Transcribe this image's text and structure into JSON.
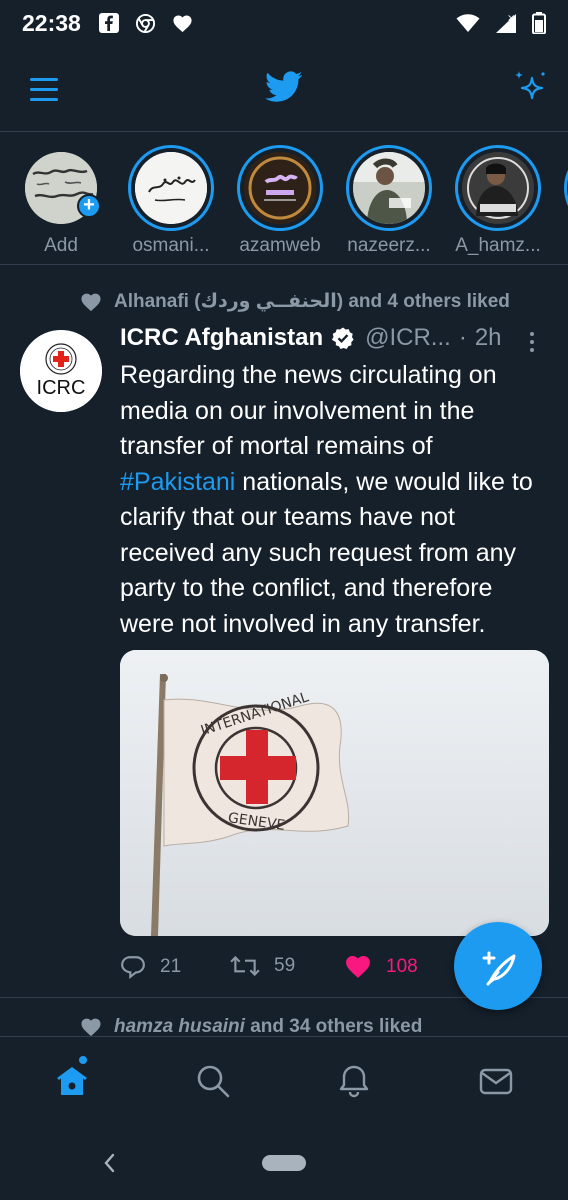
{
  "status_bar": {
    "time": "22:38",
    "left_icons": [
      "facebook-icon",
      "chrome-icon",
      "heart-icon"
    ],
    "right_icons": [
      "wifi-icon",
      "signal-icon",
      "battery-icon"
    ]
  },
  "app_bar": {
    "left_icon": "menu-icon",
    "center_icon": "twitter-bird-icon",
    "right_icon": "sparkle-icon"
  },
  "fleets": [
    {
      "label": "Add",
      "ring": false,
      "badge": "+"
    },
    {
      "label": "osmani..."
    },
    {
      "label": "azamweb"
    },
    {
      "label": "nazeerz..."
    },
    {
      "label": "A_hamz..."
    }
  ],
  "tweet": {
    "social_context": "Alhanafi (الحنفــي وردك) and 4 others liked",
    "name": "ICRC Afghanistan",
    "handle": "@ICR...",
    "separator": "·",
    "time": "2h",
    "avatar_text": "ICRC",
    "body": {
      "part1": "Regarding the news circulating on media on our involvement in the transfer of mortal remains of ",
      "hashtag": "#Pakistani",
      "part2": " nationals, we would like to clarify that our teams have not received any such request from any party to the conflict, and therefore were not involved in any transfer."
    },
    "actions": {
      "replies": "21",
      "retweets": "59",
      "likes": "108"
    }
  },
  "next_tweet": {
    "social_context_name": "hamza husaini",
    "social_context_rest": " and 34 others liked"
  },
  "bottom_nav": [
    "home-icon",
    "search-icon",
    "notifications-icon",
    "messages-icon"
  ],
  "colors": {
    "background": "#15202b",
    "accent": "#1d9bf0",
    "like": "#f91880",
    "muted": "#8b98a5",
    "divider": "#2f3d4c"
  }
}
